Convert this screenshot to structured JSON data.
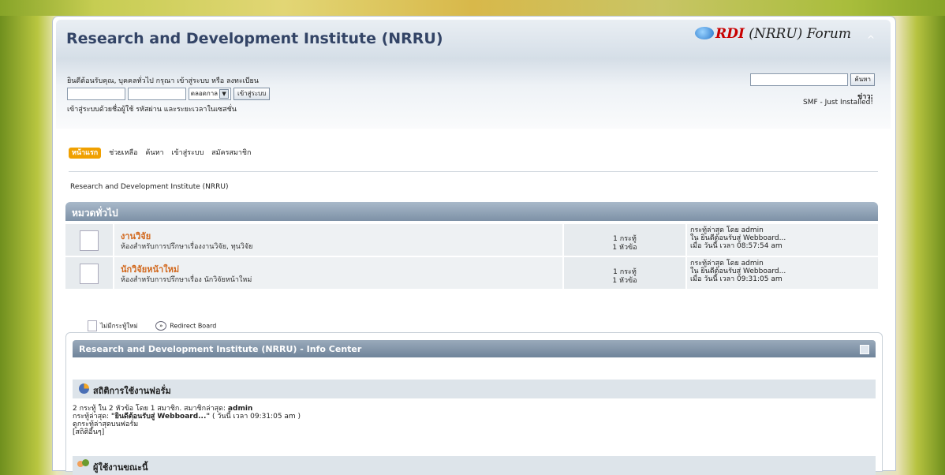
{
  "header": {
    "site_title": "Research and Development Institute (NRRU)",
    "logo_brand": "RDI",
    "logo_rest": "(NRRU) Forum",
    "collapse_glyph": "^"
  },
  "userbar": {
    "welcome": "ยินดีต้อนรับคุณ, บุคคลทั่วไป กรุณา เข้าสู่ระบบ หรือ ลงทะเบียน",
    "duration_option": "ตลอดกาล",
    "login_button": "เข้าสู่ระบบ",
    "login_note": "เข้าสู่ระบบด้วยชื่อผู้ใช้ รหัสผ่าน และระยะเวลาในเซสชั่น",
    "search_button": "ค้นหา",
    "news_label": "ข่าว:",
    "news_text": "SMF - Just Installed!"
  },
  "menu": [
    "หน้าแรก",
    "ช่วยเหลือ",
    "ค้นหา",
    "เข้าสู่ระบบ",
    "สมัครสมาชิก"
  ],
  "breadcrumb": "Research and Development Institute (NRRU)",
  "category": {
    "title": "หมวดทั่วไป"
  },
  "boards": [
    {
      "name": "งานวิจัย",
      "description": "ห้องสำหรับการปรึกษาเรื่องงานวิจัย, ทุนวิจัย",
      "posts": "1 กระทู้",
      "topics": "1 หัวข้อ",
      "last_by": "กระทู้ล่าสุด โดย admin",
      "last_in": "ใน ยินดีต้อนรับสู่ Webboard...",
      "last_time": "เมื่อ วันนี้ เวลา 08:57:54 am"
    },
    {
      "name": "นักวิจัยหน้าใหม่",
      "description": "ห้องสำหรับการปรึกษาเรื่อง นักวิจัยหน้าใหม่",
      "posts": "1 กระทู้",
      "topics": "1 หัวข้อ",
      "last_by": "กระทู้ล่าสุด โดย admin",
      "last_in": "ใน ยินดีต้อนรับสู่ Webboard...",
      "last_time": "เมื่อ วันนี้ เวลา 09:31:05 am"
    }
  ],
  "legend": {
    "no_new": "ไม่มีกระทู้ใหม่",
    "redirect": "Redirect Board"
  },
  "info_center": {
    "title": "Research and Development Institute (NRRU) - Info Center",
    "stats_heading": "สถิติการใช้งานฟอรั่ม",
    "stats_line1_pre": "2 กระทู้ ใน 2 หัวข้อ โดย 1 สมาชิก. สมาชิกล่าสุด:",
    "stats_line1_user": "admin",
    "stats_line2_pre": "กระทู้ล่าสุด:",
    "stats_line2_title": "\"ยินดีต้อนรับสู่ Webboard...\"",
    "stats_line2_post": "( วันนี้ เวลา 09:31:05 am )",
    "stats_line3": "ดูกระทู้ล่าสุดบนฟอรั่ม",
    "stats_line4": "[สถิติอื่นๆ]",
    "online_heading": "ผู้ใช้งานขณะนี้"
  }
}
